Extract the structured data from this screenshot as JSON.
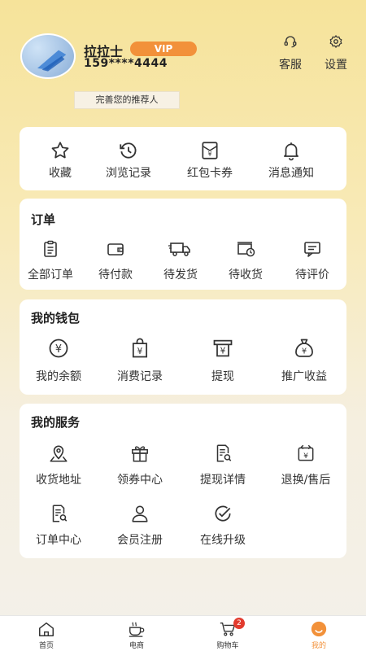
{
  "profile": {
    "name": "拉拉士",
    "vip_label": "VIP",
    "phone": "159****4444",
    "referrer_button": "完善您的推荐人"
  },
  "header_actions": {
    "service": "客服",
    "settings": "设置"
  },
  "quick_links": [
    {
      "label": "收藏",
      "icon": "star-icon"
    },
    {
      "label": "浏览记录",
      "icon": "history-icon"
    },
    {
      "label": "红包卡券",
      "icon": "coupon-icon"
    },
    {
      "label": "消息通知",
      "icon": "bell-icon"
    }
  ],
  "orders": {
    "title": "订单",
    "items": [
      {
        "label": "全部订单",
        "icon": "clipboard-icon"
      },
      {
        "label": "待付款",
        "icon": "wallet-icon"
      },
      {
        "label": "待发货",
        "icon": "truck-icon"
      },
      {
        "label": "待收货",
        "icon": "box-clock-icon"
      },
      {
        "label": "待评价",
        "icon": "comment-icon"
      }
    ]
  },
  "wallet": {
    "title": "我的钱包",
    "items": [
      {
        "label": "我的余额",
        "icon": "yen-circle-icon"
      },
      {
        "label": "消费记录",
        "icon": "yen-bag-icon"
      },
      {
        "label": "提现",
        "icon": "yen-withdraw-icon"
      },
      {
        "label": "推广收益",
        "icon": "money-bag-icon"
      }
    ]
  },
  "services": {
    "title": "我的服务",
    "items": [
      {
        "label": "收货地址",
        "icon": "location-icon"
      },
      {
        "label": "领券中心",
        "icon": "gift-icon"
      },
      {
        "label": "提现详情",
        "icon": "document-search-icon"
      },
      {
        "label": "退换/售后",
        "icon": "exchange-icon"
      },
      {
        "label": "订单中心",
        "icon": "order-search-icon"
      },
      {
        "label": "会员注册",
        "icon": "user-icon"
      },
      {
        "label": "在线升级",
        "icon": "check-circle-icon"
      }
    ]
  },
  "tabbar": {
    "tabs": [
      {
        "label": "首页",
        "icon": "home-icon"
      },
      {
        "label": "电商",
        "icon": "coffee-icon"
      },
      {
        "label": "购物车",
        "icon": "cart-icon",
        "badge": "2"
      },
      {
        "label": "我的",
        "icon": "smile-icon",
        "active": true
      }
    ]
  },
  "colors": {
    "accent": "#f2913a",
    "badge": "#e23b2e",
    "background_top": "#f6e39a",
    "card": "#ffffff"
  }
}
